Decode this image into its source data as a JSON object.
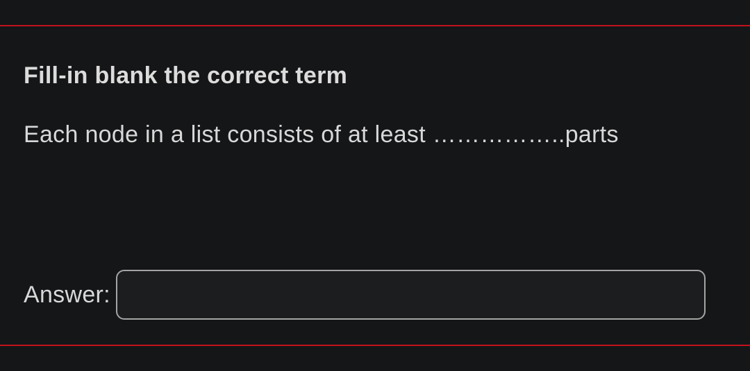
{
  "question": {
    "instruction": "Fill-in blank the correct term",
    "text": "Each node in a list consists of at least ……………..parts",
    "answer_label": "Answer:",
    "answer_value": ""
  },
  "colors": {
    "accent": "#c4121b",
    "background": "#151618",
    "text": "#d8d8d8",
    "input_border": "#a5a5a5",
    "input_bg": "#1c1d1f"
  }
}
